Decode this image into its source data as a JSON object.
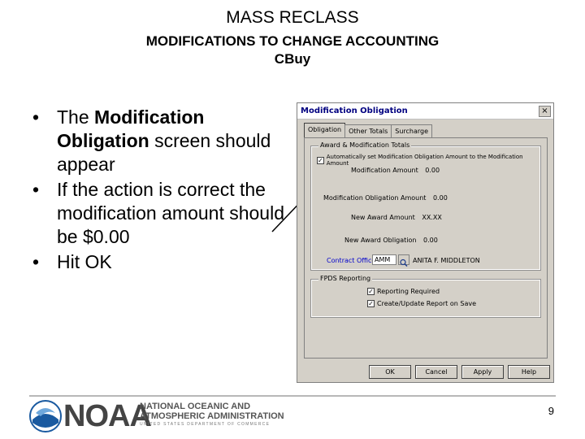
{
  "slide": {
    "title": "MASS RECLASS",
    "subtitle_line1": "MODIFICATIONS TO CHANGE ACCOUNTING",
    "subtitle_line2": "CBuy",
    "bullets": [
      {
        "before": "The ",
        "bold": "Modification Obligation",
        "after": " screen should appear"
      },
      {
        "text": "If the action is correct the modification amount should be $0.00"
      },
      {
        "text": "Hit OK"
      }
    ],
    "page_number": "9"
  },
  "dialog": {
    "title": "Modification Obligation",
    "close": "×",
    "tabs": [
      "Obligation",
      "Other Totals",
      "Surcharge"
    ],
    "group1_label": "Award & Modification Totals",
    "auto_calc_label": "Automatically set Modification Obligation Amount to the Modification Amount",
    "mod_amount_label": "Modification Amount",
    "mod_amount_value": "0.00",
    "mod_obl_amount_label": "Modification Obligation Amount",
    "mod_obl_amount_value": "0.00",
    "new_award_amount_label": "New Award Amount",
    "new_award_amount_value": "XX.XX",
    "new_award_obligation_label": "New Award Obligation",
    "new_award_obligation_value": "0.00",
    "contract_officer_label": "Contract Officer",
    "contract_officer_code": "AMM",
    "contract_officer_name": "ANITA F. MIDDLETON",
    "group2_label": "FPDS Reporting",
    "reporting_required": "Reporting Required",
    "create_update": "Create/Update Report on Save",
    "buttons": {
      "ok": "OK",
      "cancel": "Cancel",
      "apply": "Apply",
      "help": "Help"
    }
  },
  "footer": {
    "logo_text": "NOAA",
    "org_line1": "NATIONAL OCEANIC AND",
    "org_line2": "ATMOSPHERIC ADMINISTRATION",
    "dept": "UNITED STATES DEPARTMENT OF COMMERCE"
  },
  "colors": {
    "title_blue": "#000080",
    "dialog_gray": "#d4d0c8",
    "link_blue": "#0000cc",
    "logo_blue": "#1a5aa0"
  }
}
